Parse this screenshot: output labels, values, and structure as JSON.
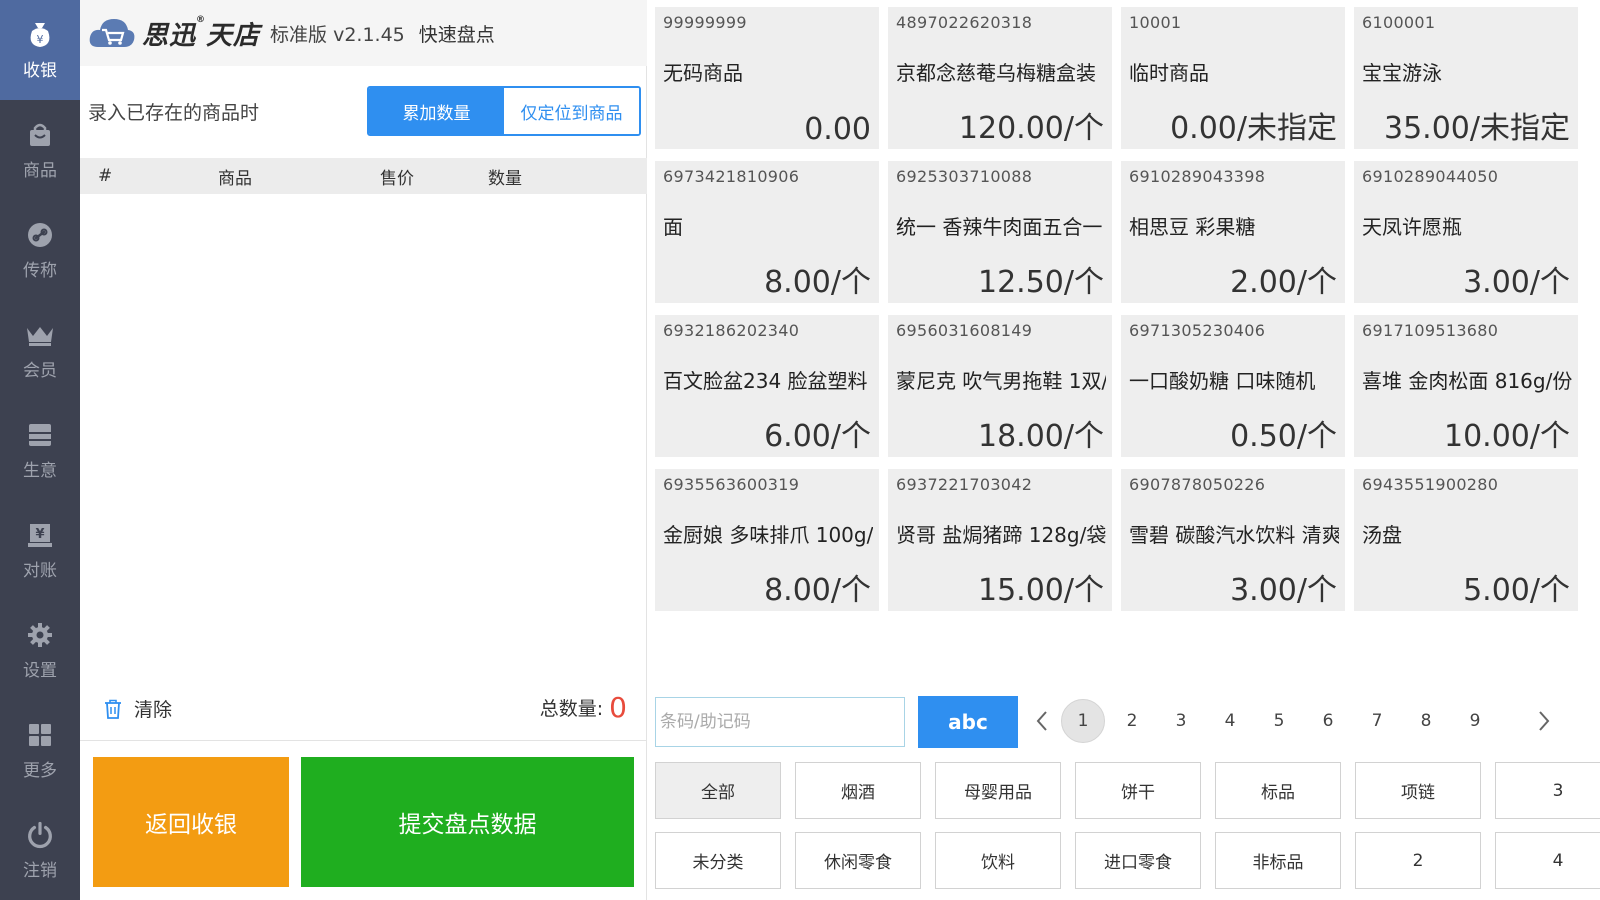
{
  "sidebar": {
    "items": [
      {
        "label": "收银",
        "icon": "cashier-bag-icon",
        "active": true
      },
      {
        "label": "商品",
        "icon": "shopping-bag-icon",
        "active": false
      },
      {
        "label": "传称",
        "icon": "scale-link-icon",
        "active": false
      },
      {
        "label": "会员",
        "icon": "crown-icon",
        "active": false
      },
      {
        "label": "生意",
        "icon": "business-book-icon",
        "active": false
      },
      {
        "label": "对账",
        "icon": "reconcile-yen-icon",
        "active": false
      },
      {
        "label": "设置",
        "icon": "gear-icon",
        "active": false
      },
      {
        "label": "更多",
        "icon": "grid-more-icon",
        "active": false
      },
      {
        "label": "注销",
        "icon": "power-icon",
        "active": false
      }
    ]
  },
  "header": {
    "brand": "思迅",
    "brand_mark": "®",
    "brand_suffix": "天店",
    "edition": "标准版 v2.1.45",
    "mode": "快速盘点"
  },
  "entry_mode": {
    "prompt": "录入已存在的商品时",
    "option_add": "累加数量",
    "option_locate": "仅定位到商品",
    "selected": "累加数量"
  },
  "table": {
    "headers": {
      "index": "#",
      "name": "商品",
      "price": "售价",
      "qty": "数量"
    },
    "rows": []
  },
  "footer": {
    "clear_label": "清除",
    "total_label": "总数量:",
    "total_value": "0",
    "return_label": "返回收银",
    "submit_label": "提交盘点数据"
  },
  "products": [
    {
      "code": "99999999",
      "name": "无码商品",
      "price": "0.00"
    },
    {
      "code": "4897022620318",
      "name": "京都念慈菴乌梅糖盒装",
      "price": "120.00/个"
    },
    {
      "code": "10001",
      "name": "临时商品",
      "price": "0.00/未指定"
    },
    {
      "code": "6100001",
      "name": "宝宝游泳",
      "price": "35.00/未指定"
    },
    {
      "code": "6973421810906",
      "name": "面",
      "price": "8.00/个"
    },
    {
      "code": "6925303710088",
      "name": "统一 香辣牛肉面五合一",
      "price": "12.50/个"
    },
    {
      "code": "6910289043398",
      "name": "相思豆 彩果糖",
      "price": "2.00/个"
    },
    {
      "code": "6910289044050",
      "name": "天凤许愿瓶",
      "price": "3.00/个"
    },
    {
      "code": "6932186202340",
      "name": "百文脸盆234 脸盆塑料",
      "price": "6.00/个"
    },
    {
      "code": "6956031608149",
      "name": "蒙尼克 吹气男拖鞋 1双/",
      "price": "18.00/个"
    },
    {
      "code": "6971305230406",
      "name": "一口酸奶糖 口味随机",
      "price": "0.50/个"
    },
    {
      "code": "6917109513680",
      "name": "喜堆 金肉松面 816g/份",
      "price": "10.00/个"
    },
    {
      "code": "6935563600319",
      "name": "金厨娘 多味排爪 100g/",
      "price": "8.00/个"
    },
    {
      "code": "6937221703042",
      "name": "贤哥 盐焗猪蹄 128g/袋",
      "price": "15.00/个"
    },
    {
      "code": "6907878050226",
      "name": "雪碧 碳酸汽水饮料 清爽",
      "price": "3.00/个"
    },
    {
      "code": "6943551900280",
      "name": "汤盘",
      "price": "5.00/个"
    }
  ],
  "search": {
    "placeholder": "条码/助记码",
    "value": "",
    "keyboard_label": "abc"
  },
  "pager": {
    "pages": [
      "1",
      "2",
      "3",
      "4",
      "5",
      "6",
      "7",
      "8",
      "9"
    ],
    "current": "1"
  },
  "categories": {
    "row1": [
      "全部",
      "烟酒",
      "母婴用品",
      "饼干",
      "标品",
      "项链",
      "3"
    ],
    "row2": [
      "未分类",
      "休闲零食",
      "饮料",
      "进口零食",
      "非标品",
      "2",
      "4"
    ],
    "selected": "全部"
  },
  "colors": {
    "sidebar_bg": "#3d4150",
    "sidebar_active": "#4f6aa0",
    "accent_blue": "#2f8ff0",
    "return_orange": "#f39c12",
    "submit_green": "#1fae1f",
    "total_red": "#e84b3c"
  }
}
